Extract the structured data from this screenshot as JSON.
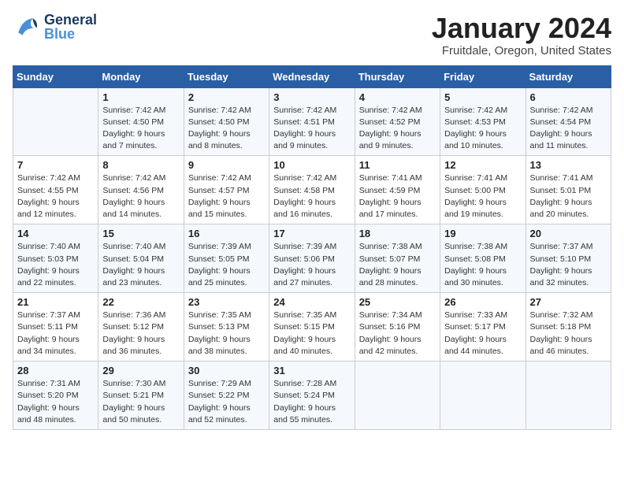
{
  "header": {
    "logo_general": "General",
    "logo_blue": "Blue",
    "title": "January 2024",
    "location": "Fruitdale, Oregon, United States"
  },
  "days_of_week": [
    "Sunday",
    "Monday",
    "Tuesday",
    "Wednesday",
    "Thursday",
    "Friday",
    "Saturday"
  ],
  "weeks": [
    [
      {
        "day": "",
        "info": ""
      },
      {
        "day": "1",
        "info": "Sunrise: 7:42 AM\nSunset: 4:50 PM\nDaylight: 9 hours\nand 7 minutes."
      },
      {
        "day": "2",
        "info": "Sunrise: 7:42 AM\nSunset: 4:50 PM\nDaylight: 9 hours\nand 8 minutes."
      },
      {
        "day": "3",
        "info": "Sunrise: 7:42 AM\nSunset: 4:51 PM\nDaylight: 9 hours\nand 9 minutes."
      },
      {
        "day": "4",
        "info": "Sunrise: 7:42 AM\nSunset: 4:52 PM\nDaylight: 9 hours\nand 9 minutes."
      },
      {
        "day": "5",
        "info": "Sunrise: 7:42 AM\nSunset: 4:53 PM\nDaylight: 9 hours\nand 10 minutes."
      },
      {
        "day": "6",
        "info": "Sunrise: 7:42 AM\nSunset: 4:54 PM\nDaylight: 9 hours\nand 11 minutes."
      }
    ],
    [
      {
        "day": "7",
        "info": "Sunrise: 7:42 AM\nSunset: 4:55 PM\nDaylight: 9 hours\nand 12 minutes."
      },
      {
        "day": "8",
        "info": "Sunrise: 7:42 AM\nSunset: 4:56 PM\nDaylight: 9 hours\nand 14 minutes."
      },
      {
        "day": "9",
        "info": "Sunrise: 7:42 AM\nSunset: 4:57 PM\nDaylight: 9 hours\nand 15 minutes."
      },
      {
        "day": "10",
        "info": "Sunrise: 7:42 AM\nSunset: 4:58 PM\nDaylight: 9 hours\nand 16 minutes."
      },
      {
        "day": "11",
        "info": "Sunrise: 7:41 AM\nSunset: 4:59 PM\nDaylight: 9 hours\nand 17 minutes."
      },
      {
        "day": "12",
        "info": "Sunrise: 7:41 AM\nSunset: 5:00 PM\nDaylight: 9 hours\nand 19 minutes."
      },
      {
        "day": "13",
        "info": "Sunrise: 7:41 AM\nSunset: 5:01 PM\nDaylight: 9 hours\nand 20 minutes."
      }
    ],
    [
      {
        "day": "14",
        "info": "Sunrise: 7:40 AM\nSunset: 5:03 PM\nDaylight: 9 hours\nand 22 minutes."
      },
      {
        "day": "15",
        "info": "Sunrise: 7:40 AM\nSunset: 5:04 PM\nDaylight: 9 hours\nand 23 minutes."
      },
      {
        "day": "16",
        "info": "Sunrise: 7:39 AM\nSunset: 5:05 PM\nDaylight: 9 hours\nand 25 minutes."
      },
      {
        "day": "17",
        "info": "Sunrise: 7:39 AM\nSunset: 5:06 PM\nDaylight: 9 hours\nand 27 minutes."
      },
      {
        "day": "18",
        "info": "Sunrise: 7:38 AM\nSunset: 5:07 PM\nDaylight: 9 hours\nand 28 minutes."
      },
      {
        "day": "19",
        "info": "Sunrise: 7:38 AM\nSunset: 5:08 PM\nDaylight: 9 hours\nand 30 minutes."
      },
      {
        "day": "20",
        "info": "Sunrise: 7:37 AM\nSunset: 5:10 PM\nDaylight: 9 hours\nand 32 minutes."
      }
    ],
    [
      {
        "day": "21",
        "info": "Sunrise: 7:37 AM\nSunset: 5:11 PM\nDaylight: 9 hours\nand 34 minutes."
      },
      {
        "day": "22",
        "info": "Sunrise: 7:36 AM\nSunset: 5:12 PM\nDaylight: 9 hours\nand 36 minutes."
      },
      {
        "day": "23",
        "info": "Sunrise: 7:35 AM\nSunset: 5:13 PM\nDaylight: 9 hours\nand 38 minutes."
      },
      {
        "day": "24",
        "info": "Sunrise: 7:35 AM\nSunset: 5:15 PM\nDaylight: 9 hours\nand 40 minutes."
      },
      {
        "day": "25",
        "info": "Sunrise: 7:34 AM\nSunset: 5:16 PM\nDaylight: 9 hours\nand 42 minutes."
      },
      {
        "day": "26",
        "info": "Sunrise: 7:33 AM\nSunset: 5:17 PM\nDaylight: 9 hours\nand 44 minutes."
      },
      {
        "day": "27",
        "info": "Sunrise: 7:32 AM\nSunset: 5:18 PM\nDaylight: 9 hours\nand 46 minutes."
      }
    ],
    [
      {
        "day": "28",
        "info": "Sunrise: 7:31 AM\nSunset: 5:20 PM\nDaylight: 9 hours\nand 48 minutes."
      },
      {
        "day": "29",
        "info": "Sunrise: 7:30 AM\nSunset: 5:21 PM\nDaylight: 9 hours\nand 50 minutes."
      },
      {
        "day": "30",
        "info": "Sunrise: 7:29 AM\nSunset: 5:22 PM\nDaylight: 9 hours\nand 52 minutes."
      },
      {
        "day": "31",
        "info": "Sunrise: 7:28 AM\nSunset: 5:24 PM\nDaylight: 9 hours\nand 55 minutes."
      },
      {
        "day": "",
        "info": ""
      },
      {
        "day": "",
        "info": ""
      },
      {
        "day": "",
        "info": ""
      }
    ]
  ]
}
